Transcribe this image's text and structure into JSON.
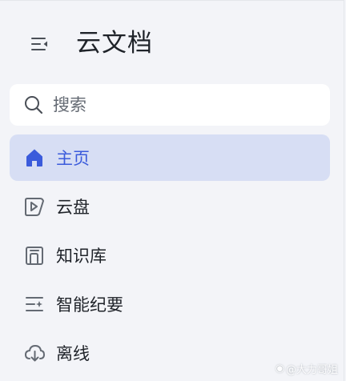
{
  "sidebar": {
    "title": "云文档",
    "collapse_icon": "sidebar-collapse-icon",
    "search": {
      "placeholder": "搜索",
      "value": ""
    },
    "items": [
      {
        "label": "主页",
        "icon": "home-icon",
        "active": true
      },
      {
        "label": "云盘",
        "icon": "cloud-drive-icon",
        "active": false
      },
      {
        "label": "知识库",
        "icon": "knowledge-base-icon",
        "active": false
      },
      {
        "label": "智能纪要",
        "icon": "smart-minutes-icon",
        "active": false
      },
      {
        "label": "离线",
        "icon": "offline-download-icon",
        "active": false
      }
    ]
  },
  "colors": {
    "accent": "#3b5bdb",
    "active_bg": "#d7def4",
    "icon_gray": "#646a73",
    "background": "#f3f4f8"
  },
  "watermark": {
    "text": "@大力哥姐"
  }
}
